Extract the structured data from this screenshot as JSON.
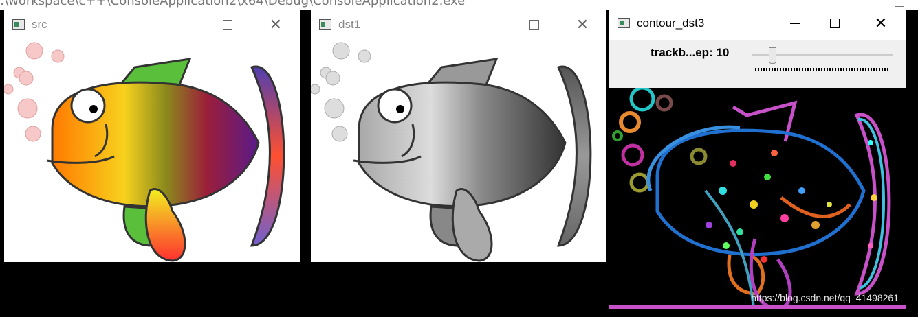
{
  "console": {
    "title": ":\\workspace\\c++\\ConsoleApplication2\\x64\\Debug\\ConsoleApplication2.exe"
  },
  "windows": [
    {
      "title": "src"
    },
    {
      "title": "dst1"
    },
    {
      "title": "contour_dst3"
    }
  ],
  "trackbar": {
    "label": "trackb...ep: 10",
    "value": 10
  },
  "watermark": "https://blog.csdn.net/qq_41498261",
  "colors": {
    "console_bg": "#000000",
    "active_border": "#e8c46a"
  }
}
